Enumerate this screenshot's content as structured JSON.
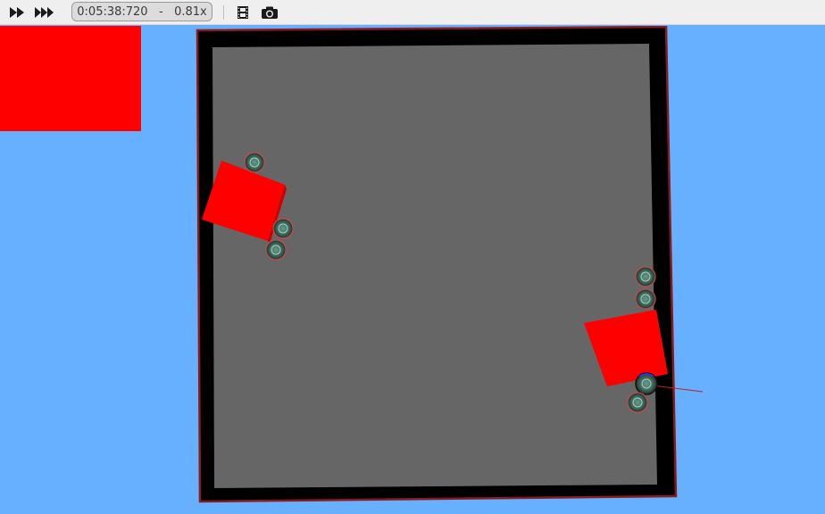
{
  "toolbar": {
    "play_fast_icon": "fast-forward-icon",
    "play_faster_icon": "fastest-forward-icon",
    "time": "0:05:38:720",
    "separator": "-",
    "speed": "0.81x",
    "movie_icon": "film-icon",
    "screenshot_icon": "camera-icon"
  },
  "scene": {
    "background_color": "#66b0ff",
    "floor_color": "#666666",
    "wall_color": "#000000",
    "wall_edge_color": "#8b1a1a",
    "box_color": "#ff0000",
    "robot_count": 8
  }
}
